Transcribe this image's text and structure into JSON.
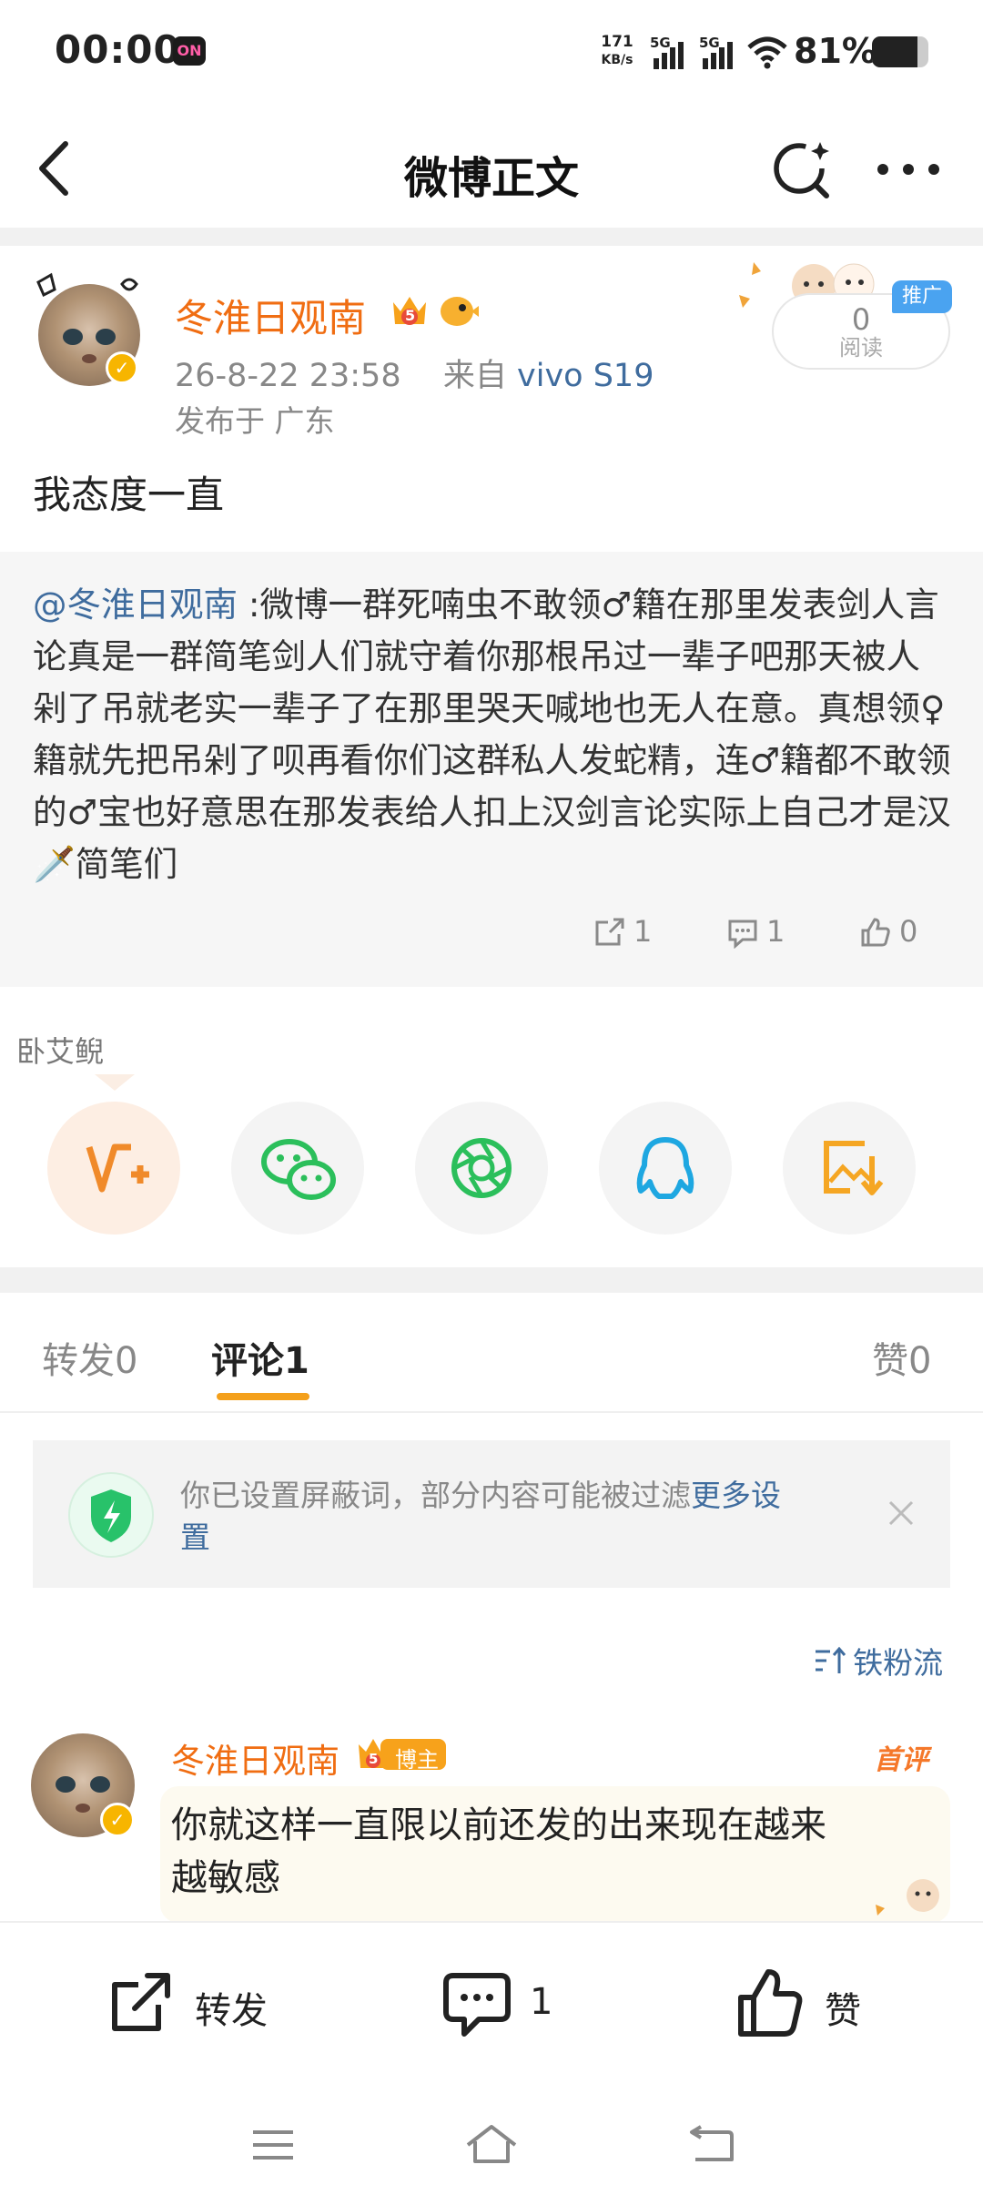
{
  "status_bar": {
    "time": "00:00",
    "on_badge": "ON",
    "net_speed_value": "171",
    "net_speed_unit": "KB/s",
    "sig1_label": "5G",
    "sig2_label": "5G",
    "battery_percent": "81%",
    "battery_level": 0.81
  },
  "nav": {
    "title": "微博正文"
  },
  "post": {
    "author": "冬淮日观南",
    "crown_level": "5",
    "time": "26-8-22 23:58",
    "source_prefix": "来自",
    "source_device": "vivo S19",
    "location": "发布于 广东",
    "read_count": "0",
    "read_label": "阅读",
    "promo_label": "推广",
    "text": "我态度一直"
  },
  "repost": {
    "mention": "@冬淮日观南",
    "text": " :微博一群死喃虫不敢领♂籍在那里发表剑人言论真是一群简笔剑人们就守着你那根吊过一辈子吧那天被人剁了吊就老实一辈子了在那里哭天喊地也无人在意。真想领♀籍就先把吊剁了呗再看你们这群私人发蛇精，连♂籍都不敢领的♂宝也好意思在那发表给人扣上汉剑言论实际上自己才是汉🗡️简笔们",
    "reposts": "1",
    "comments": "1",
    "likes": "0"
  },
  "share": {
    "label": "卧艾鲵",
    "items": [
      "weibo-share-icon",
      "wechat-icon",
      "moments-icon",
      "qq-icon",
      "save-image-icon"
    ]
  },
  "tabs": {
    "repost_label": "转发",
    "repost_count": "0",
    "comment_label": "评论",
    "comment_count": "1",
    "like_label": "赞",
    "like_count": "0"
  },
  "notice": {
    "text": "你已设置屏蔽词，部分内容可能被过滤",
    "link_part1": "更多设",
    "link_part2": "置"
  },
  "sort": {
    "label": "铁粉流"
  },
  "comment": {
    "author": "冬淮日观南",
    "crown_level": "5",
    "badge": "博主",
    "first_tag": "首评",
    "text_line1": "你就这样一直限以前还发的出来现在越来",
    "text_line2": "越敏感"
  },
  "bottom_bar": {
    "repost_label": "转发",
    "comment_count": "1",
    "like_label": "赞"
  },
  "colors": {
    "accent_orange": "#f06d12",
    "link_blue": "#3f6c9e",
    "tab_underline": "#f4a01b"
  }
}
